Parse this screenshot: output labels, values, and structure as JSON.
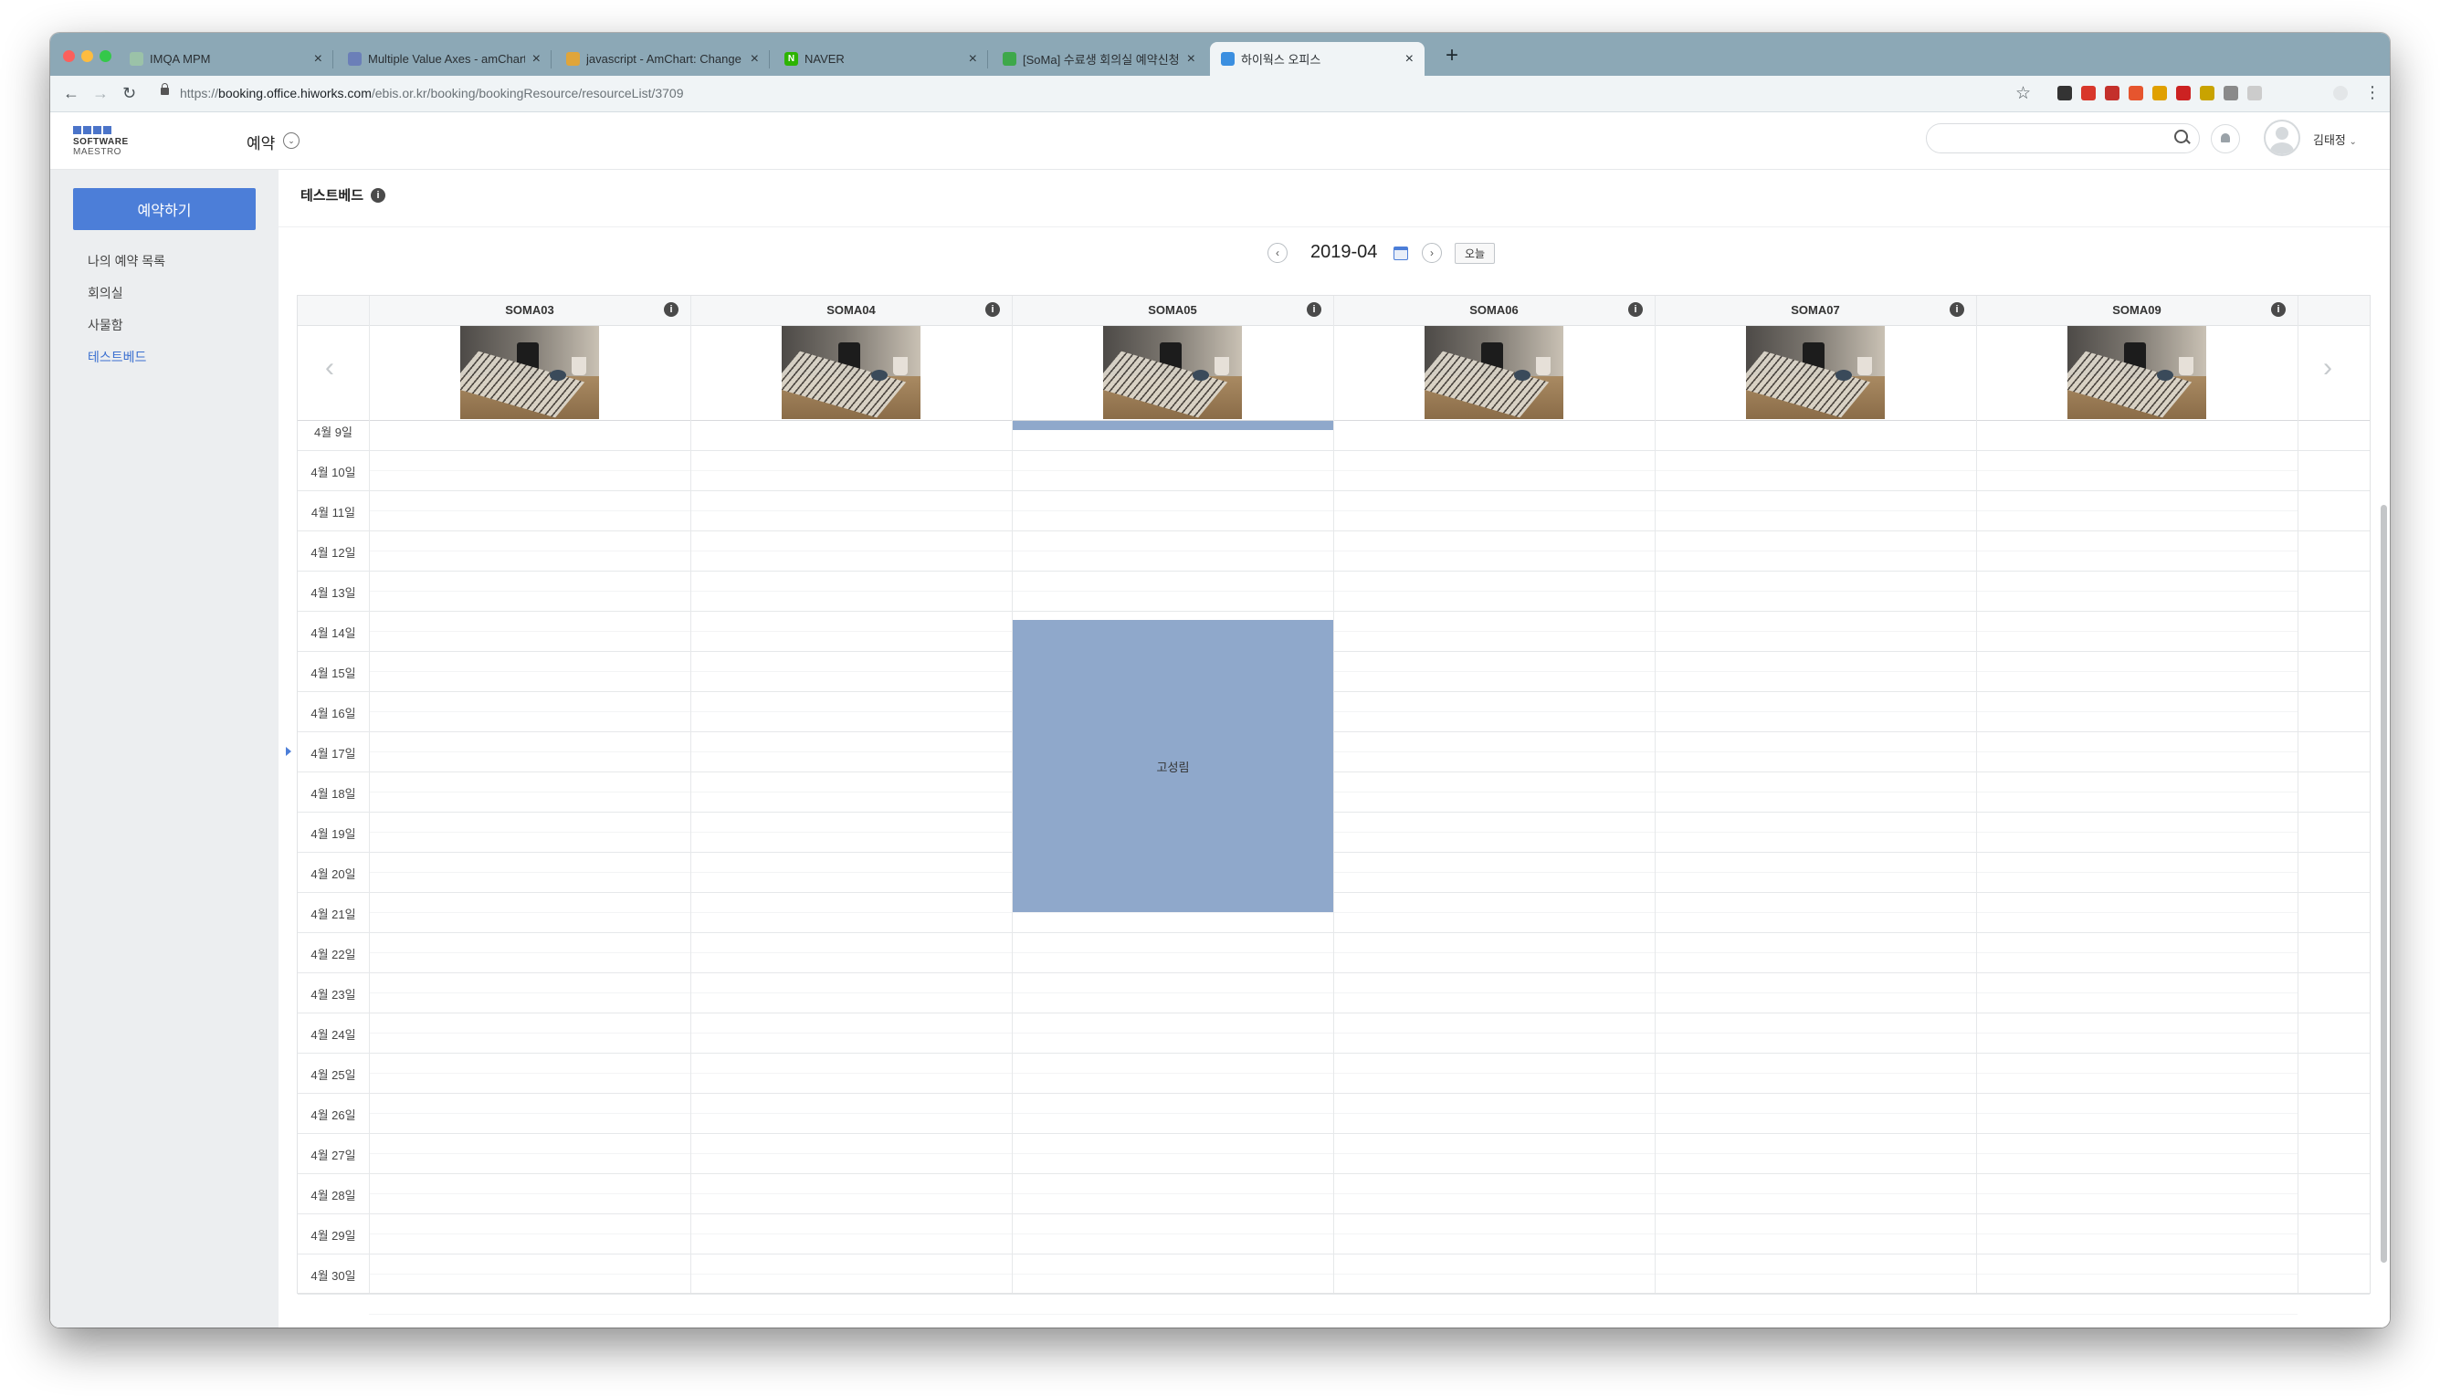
{
  "browser": {
    "tabs": [
      {
        "title": "IMQA MPM",
        "favicon_color": "#9bc2a8",
        "favicon_glyph": "",
        "active": false
      },
      {
        "title": "Multiple Value Axes - amChart",
        "favicon_color": "#6b7fb8",
        "favicon_glyph": "",
        "active": false
      },
      {
        "title": "javascript - AmChart: Change",
        "favicon_color": "#e0a53a",
        "favicon_glyph": "",
        "active": false
      },
      {
        "title": "NAVER",
        "favicon_color": "#2db400",
        "favicon_glyph": "N",
        "active": false
      },
      {
        "title": "[SoMa] 수료생 회의실 예약신청 방",
        "favicon_color": "#3ea84a",
        "favicon_glyph": "",
        "active": false
      },
      {
        "title": "하이웍스 오피스",
        "favicon_color": "#3b8fe0",
        "favicon_glyph": "",
        "active": true
      }
    ],
    "url_prefix": "https://",
    "url_host": "booking.office.hiworks.com",
    "url_path": "/ebis.or.kr/booking/bookingResource/resourceList/3709",
    "extension_colors": [
      "#333333",
      "#d8372b",
      "#c4302b",
      "#e6552e",
      "#e0a000",
      "#cc2222",
      "#c9a300",
      "#8a8a8a",
      "#cccccc"
    ]
  },
  "header": {
    "logo_line1": "SOFTWARE",
    "logo_line2": "MAESTRO",
    "menu_title": "예약",
    "search_placeholder": "",
    "user_name": "김태정",
    "accent_color": "#4c7ed8"
  },
  "sidebar": {
    "reserve_button": "예약하기",
    "items": [
      {
        "label": "나의 예약 목록",
        "active": false
      },
      {
        "label": "회의실",
        "active": false
      },
      {
        "label": "사물함",
        "active": false
      },
      {
        "label": "테스트베드",
        "active": true
      }
    ]
  },
  "main": {
    "section_title": "테스트베드",
    "current_month": "2019-04",
    "today_button": "오늘"
  },
  "schedule": {
    "resources": [
      "SOMA03",
      "SOMA04",
      "SOMA05",
      "SOMA06",
      "SOMA07",
      "SOMA09"
    ],
    "days": [
      "4월 9일",
      "4월 10일",
      "4월 11일",
      "4월 12일",
      "4월 13일",
      "4월 14일",
      "4월 15일",
      "4월 16일",
      "4월 17일",
      "4월 18일",
      "4월 19일",
      "4월 20일",
      "4월 21일",
      "4월 22일",
      "4월 23일",
      "4월 24일",
      "4월 25일",
      "4월 26일",
      "4월 27일",
      "4월 28일",
      "4월 29일",
      "4월 30일"
    ],
    "current_day": "4월 17일",
    "booking_color": "#8fa8cb",
    "bookings": [
      {
        "resource": "SOMA05",
        "start_day": "4월 8일",
        "end_day": "4월 9일",
        "label": ""
      },
      {
        "resource": "SOMA05",
        "start_day": "4월 14일",
        "end_day": "4월 21일",
        "label": "고성림"
      }
    ]
  }
}
